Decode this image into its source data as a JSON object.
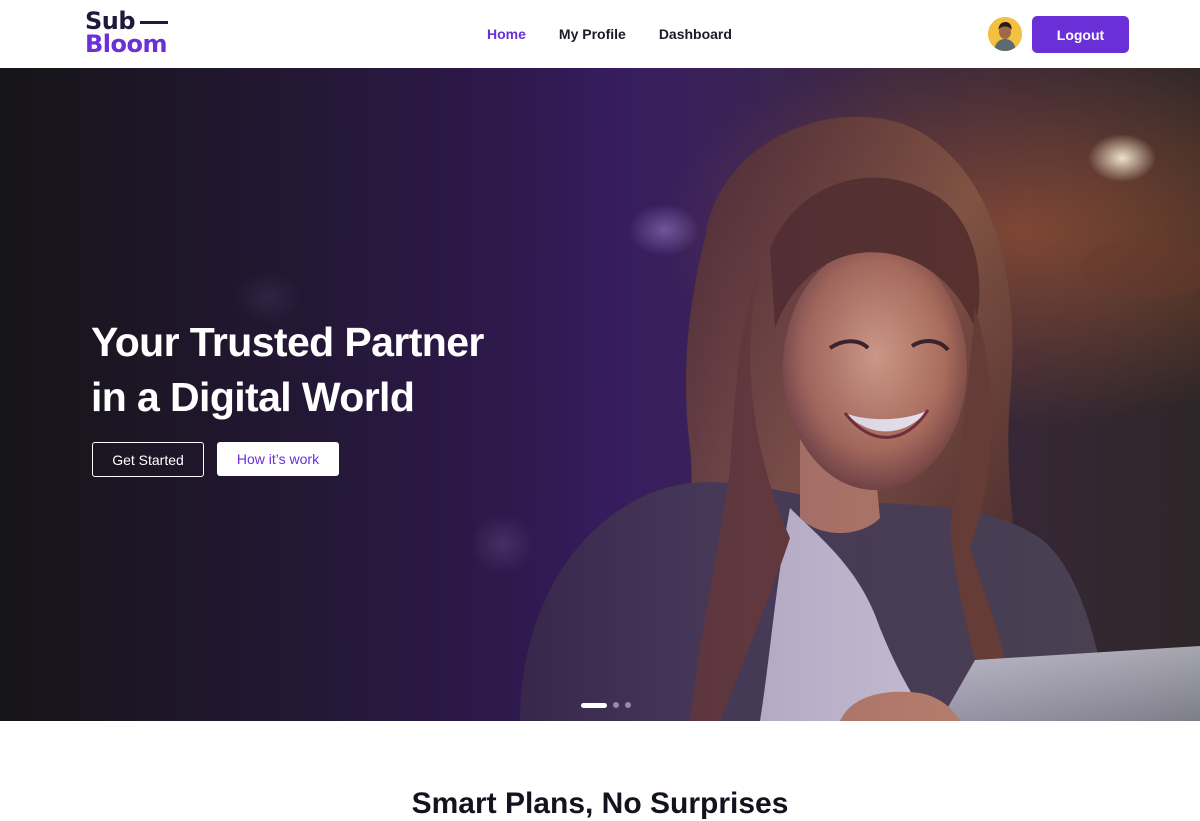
{
  "brand": {
    "line1": "Sub",
    "line2": "Bloom",
    "primary_color": "#6a2fd6",
    "dark_color": "#1f1a3d"
  },
  "nav": {
    "links": [
      {
        "label": "Home",
        "active": true
      },
      {
        "label": "My Profile",
        "active": false
      },
      {
        "label": "Dashboard",
        "active": false
      }
    ],
    "avatar_icon": "user-avatar",
    "logout_label": "Logout"
  },
  "hero": {
    "title_line1": "Your Trusted Partner",
    "title_line2": "in a Digital World",
    "primary_cta": "Get Started",
    "secondary_cta": "How it’s work",
    "slides_total": 3,
    "active_slide": 1
  },
  "section": {
    "title": "Smart Plans, No Surprises"
  }
}
